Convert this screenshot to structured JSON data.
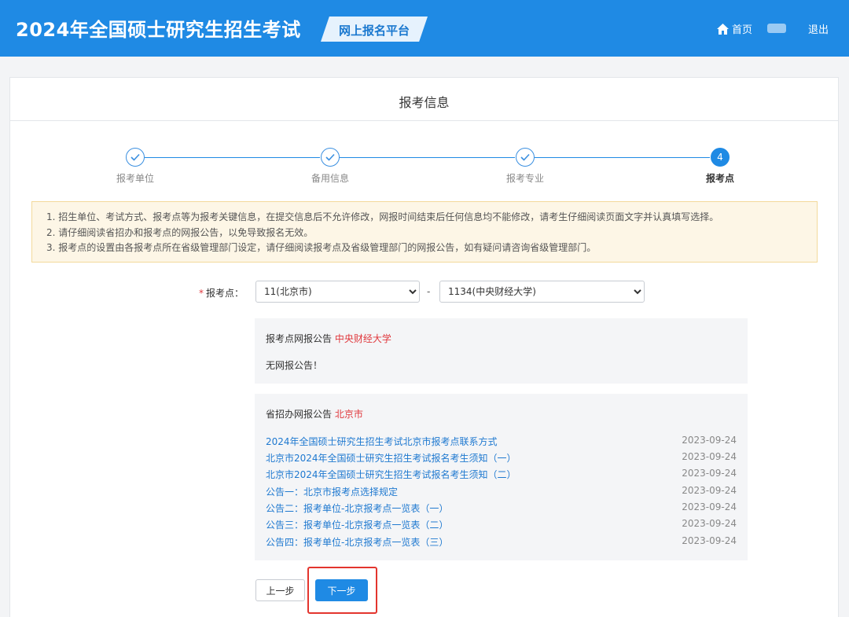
{
  "header": {
    "title": "2024年全国硕士研究生招生考试",
    "platform": "网上报名平台",
    "home_label": "首页",
    "logout_label": "退出"
  },
  "panel": {
    "title": "报考信息"
  },
  "steps": [
    {
      "label": "报考单位",
      "state": "done"
    },
    {
      "label": "备用信息",
      "state": "done"
    },
    {
      "label": "报考专业",
      "state": "done"
    },
    {
      "label": "报考点",
      "state": "active",
      "number": "4"
    }
  ],
  "notice": [
    "1. 招生单位、考试方式、报考点等为报考关键信息，在提交信息后不允许修改，网报时间结束后任何信息均不能修改，请考生仔细阅读页面文字并认真填写选择。",
    "2. 请仔细阅读省招办和报考点的网报公告，以免导致报名无效。",
    "3. 报考点的设置由各报考点所在省级管理部门设定，请仔细阅读报考点及省级管理部门的网报公告，如有疑问请咨询省级管理部门。"
  ],
  "form": {
    "label": "报考点：",
    "required_mark": "*",
    "province_value": "11(北京市)",
    "separator": "-",
    "site_value": "1134(中央财经大学)"
  },
  "site_notice": {
    "title": "报考点网报公告",
    "highlight": "中央财经大学",
    "text": "无网报公告！"
  },
  "province_notice": {
    "title": "省招办网报公告",
    "highlight": "北京市",
    "items": [
      {
        "title": "2024年全国硕士研究生招生考试北京市报考点联系方式",
        "date": "2023-09-24"
      },
      {
        "title": "北京市2024年全国硕士研究生招生考试报名考生须知（一）",
        "date": "2023-09-24"
      },
      {
        "title": "北京市2024年全国硕士研究生招生考试报名考生须知（二）",
        "date": "2023-09-24"
      },
      {
        "title": "公告一：北京市报考点选择规定",
        "date": "2023-09-24"
      },
      {
        "title": "公告二：报考单位-北京报考点一览表（一）",
        "date": "2023-09-24"
      },
      {
        "title": "公告三：报考单位-北京报考点一览表（二）",
        "date": "2023-09-24"
      },
      {
        "title": "公告四：报考单位-北京报考点一览表（三）",
        "date": "2023-09-24"
      }
    ]
  },
  "buttons": {
    "prev": "上一步",
    "next": "下一步"
  },
  "colors": {
    "primary": "#1f8ae4",
    "link": "#1f79d0",
    "highlight_text": "#e0393e",
    "annotation_border": "#e3352e"
  }
}
